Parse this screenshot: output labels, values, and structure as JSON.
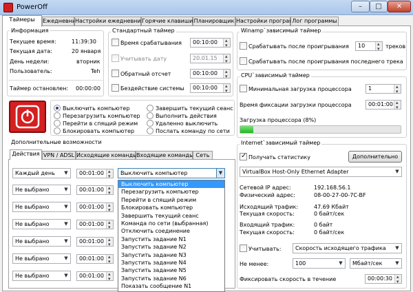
{
  "window": {
    "title": "PowerOff",
    "minimize": "–",
    "maximize": "□",
    "close": "✕"
  },
  "tabs": [
    "Таймеры",
    "Ежедневник",
    "Настройки ежедневника",
    "Горячие клавиши",
    "Планировщик",
    "Настройки программ",
    "Лог программы"
  ],
  "info": {
    "title": "Информация",
    "rows": [
      {
        "label": "Текущее время:",
        "value": "11:39:30"
      },
      {
        "label": "Текущая дата:",
        "value": "20 января"
      },
      {
        "label": "День недели:",
        "value": "вторник"
      },
      {
        "label": "Пользователь:",
        "value": "Teh"
      }
    ],
    "timer_label": "Таймер остановлен:",
    "timer_value": "00:00:00"
  },
  "std": {
    "title": "Стандартный таймер",
    "rows": [
      {
        "label": "Время срабатывания",
        "value": "00:10:00",
        "checked": false,
        "disabled": false
      },
      {
        "label": "Учитывать дату",
        "value": "20.01.15",
        "checked": false,
        "disabled": true
      },
      {
        "label": "Обратный отсчет",
        "value": "00:10:00",
        "checked": false,
        "disabled": false
      },
      {
        "label": "Бездействие системы",
        "value": "00:10:00",
        "checked": false,
        "disabled": false
      }
    ]
  },
  "actions": {
    "left": [
      "Выключить компьютер",
      "Перезагрузить компьютер",
      "Перейти в спящий режим",
      "Блокировать компьютер"
    ],
    "right": [
      "Завершить текущий сеанс",
      "Выполнить действия",
      "Удаленно выключить",
      "Послать команду по сети"
    ],
    "selected": 0
  },
  "extra": {
    "title": "Дополнительные возможности",
    "tabs": [
      "Действия",
      "VPN / ADSL",
      "Исходящие команды",
      "Входящие команды",
      "Сеть"
    ],
    "rows": [
      {
        "sched": "Каждый день",
        "time": "00:01:00",
        "action": "Выключить компьютер"
      },
      {
        "sched": "Не выбрано",
        "time": "00:01:00",
        "action": ""
      },
      {
        "sched": "Не выбрано",
        "time": "00:01:00",
        "action": ""
      },
      {
        "sched": "Не выбрано",
        "time": "00:01:00",
        "action": ""
      },
      {
        "sched": "Не выбрано",
        "time": "00:01:00",
        "action": ""
      },
      {
        "sched": "Не выбрано",
        "time": "00:01:00",
        "action": ""
      },
      {
        "sched": "Не выбрано",
        "time": "00:01:00",
        "action": ""
      }
    ],
    "dropdown": [
      "Выключить компьютер",
      "Перезагрузить компьютер",
      "Перейти в спящий режим",
      "Блокировать компьютер",
      "Завершить текущий сеанс",
      "Команда по сети (выбранная)",
      "Отключить соединение",
      "Запустить задание N1",
      "Запустить задание N2",
      "Запустить задание N3",
      "Запустить задание N4",
      "Запустить задание N5",
      "Запустить задание N6",
      "Показать сообщение N1"
    ]
  },
  "winamp": {
    "title": "Winamp`зависимый таймер",
    "opt1": "Срабатывать после проигрывания",
    "count": "10",
    "unit": "треков",
    "opt2": "Срабатывать после проигрывания последнего трека"
  },
  "cpu": {
    "title": "CPU`зависимый таймер",
    "min_label": "Минимальная загрузка процессора",
    "min_value": "1",
    "fix_label": "Время фиксации загрузки процессора",
    "fix_value": "00:01:00",
    "load_label": "Загрузка процессора (8%)",
    "load_pct": 8
  },
  "inet": {
    "title": "Internet`зависимый таймер",
    "stats_label": "Получать статистику",
    "stats_checked": true,
    "more_btn": "Дополнительно",
    "adapter": "VirtualBox Host-Only Ethernet Adapter",
    "rows": [
      {
        "label": "Сетевой IP адрес:",
        "value": "192.168.56.1"
      },
      {
        "label": "Физический адрес:",
        "value": "08-00-27-00-7C-BF"
      },
      {
        "label": "Исходящий трафик:",
        "value": "47.69 Кбайт"
      },
      {
        "label": "Текущая скорость:",
        "value": "0 байт/сек"
      },
      {
        "label": "Входящий трафик:",
        "value": "0 байт"
      },
      {
        "label": "Текущая скорость:",
        "value": "0 байт/сек"
      }
    ],
    "consider_label": "Учитывать:",
    "consider_value": "Скорость исходящего трафика",
    "notless_label": "Не менее:",
    "notless_value": "100",
    "unit_value": "Мбайт/сек",
    "fix_label": "Фиксировать скорость в течение",
    "fix_value": "00:00:30"
  },
  "colors": {
    "power": "#d42020",
    "progress": "#1db81d",
    "highlight": "#3399ff"
  }
}
